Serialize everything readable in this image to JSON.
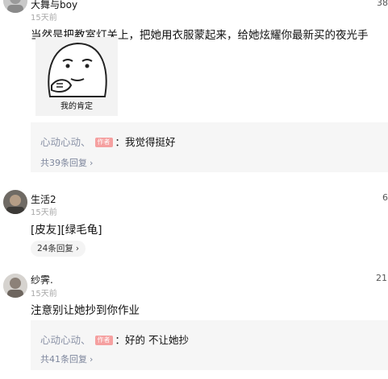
{
  "comments": [
    {
      "username": "大舞与boy",
      "time": "15天前",
      "likes": "38",
      "text": "当然是把教室灯关上，把她用衣服蒙起来，给她炫耀你最新买的夜光手",
      "sticker": {
        "caption": "我的肯定",
        "icon": "meme-face-sticker"
      },
      "reply": {
        "user": "心动心动、",
        "tag": "作者",
        "text": "：我觉得挺好",
        "count": "共39条回复",
        "chevron": "›"
      }
    },
    {
      "username": "生活2",
      "time": "15天前",
      "likes": "6",
      "text": "[皮友][绿毛龟]",
      "pill": {
        "label": "24条回复",
        "chevron": "›"
      }
    },
    {
      "username": "纱霁.",
      "time": "15天前",
      "likes": "21",
      "text": "注意别让她抄到你作业",
      "reply": {
        "user": "心动心动、",
        "tag": "作者",
        "text": "：好的 不让她抄",
        "count": "共41条回复",
        "chevron": "›"
      }
    }
  ],
  "colors": {
    "reply_user": "#8a92a6",
    "author_tag": "#f5a0a0",
    "reply_bg": "#f6f6f6",
    "timestamp": "#a8a8a8"
  }
}
